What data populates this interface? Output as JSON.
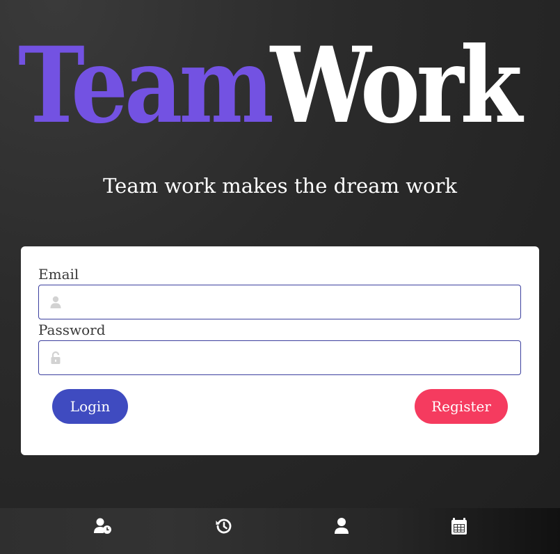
{
  "app": {
    "logo_part_1": "Team",
    "logo_part_2": "Work",
    "tagline": "Team work makes the dream work"
  },
  "login_form": {
    "email_label": "Email",
    "email_value": "",
    "email_icon": "user-icon",
    "password_label": "Password",
    "password_value": "",
    "password_icon": "unlock-icon",
    "login_label": "Login",
    "register_label": "Register"
  },
  "bottom_nav": {
    "items": [
      {
        "icon": "user-clock-icon"
      },
      {
        "icon": "history-icon"
      },
      {
        "icon": "user-icon"
      },
      {
        "icon": "calendar-icon"
      }
    ]
  },
  "colors": {
    "logo_accent": "#7352e2",
    "logo_secondary": "#ffffff",
    "login_button": "#3f4bc0",
    "register_button": "#f53b5f",
    "field_border": "#3b3f9e"
  }
}
